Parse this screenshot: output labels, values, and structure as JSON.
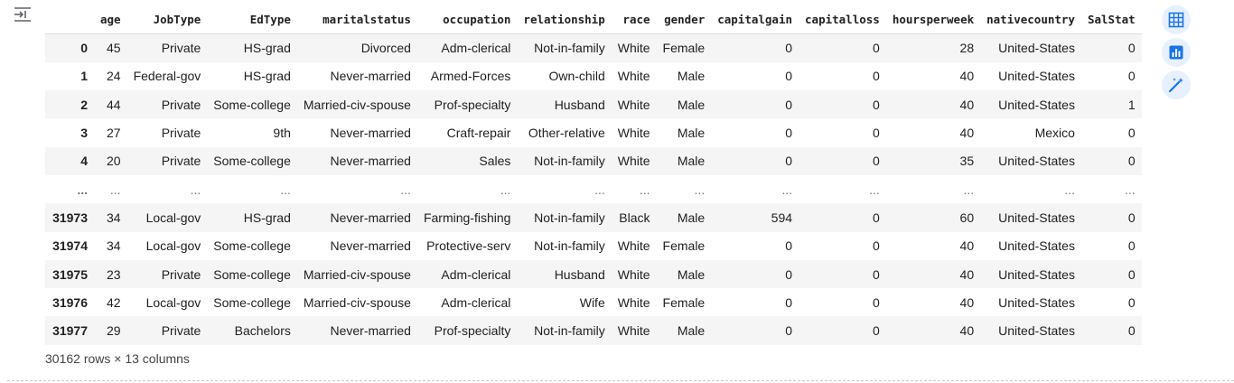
{
  "colors": {
    "accent": "#1a73e8",
    "tool_bg": "#e8f0fe",
    "stripe": "#f5f5f5",
    "text": "#212121"
  },
  "icons": {
    "collapse": "collapse-output-icon",
    "table": "table-icon",
    "chart": "chart-icon",
    "magic": "magic-wand-icon"
  },
  "table": {
    "columns": [
      "",
      "age",
      "JobType",
      "EdType",
      "maritalstatus",
      "occupation",
      "relationship",
      "race",
      "gender",
      "capitalgain",
      "capitalloss",
      "hoursperweek",
      "nativecountry",
      "SalStat"
    ],
    "rows": [
      [
        "0",
        "45",
        "Private",
        "HS-grad",
        "Divorced",
        "Adm-clerical",
        "Not-in-family",
        "White",
        "Female",
        "0",
        "0",
        "28",
        "United-States",
        "0"
      ],
      [
        "1",
        "24",
        "Federal-gov",
        "HS-grad",
        "Never-married",
        "Armed-Forces",
        "Own-child",
        "White",
        "Male",
        "0",
        "0",
        "40",
        "United-States",
        "0"
      ],
      [
        "2",
        "44",
        "Private",
        "Some-college",
        "Married-civ-spouse",
        "Prof-specialty",
        "Husband",
        "White",
        "Male",
        "0",
        "0",
        "40",
        "United-States",
        "1"
      ],
      [
        "3",
        "27",
        "Private",
        "9th",
        "Never-married",
        "Craft-repair",
        "Other-relative",
        "White",
        "Male",
        "0",
        "0",
        "40",
        "Mexico",
        "0"
      ],
      [
        "4",
        "20",
        "Private",
        "Some-college",
        "Never-married",
        "Sales",
        "Not-in-family",
        "White",
        "Male",
        "0",
        "0",
        "35",
        "United-States",
        "0"
      ],
      [
        "...",
        "...",
        "...",
        "...",
        "...",
        "...",
        "...",
        "...",
        "...",
        "...",
        "...",
        "...",
        "...",
        "..."
      ],
      [
        "31973",
        "34",
        "Local-gov",
        "HS-grad",
        "Never-married",
        "Farming-fishing",
        "Not-in-family",
        "Black",
        "Male",
        "594",
        "0",
        "60",
        "United-States",
        "0"
      ],
      [
        "31974",
        "34",
        "Local-gov",
        "Some-college",
        "Never-married",
        "Protective-serv",
        "Not-in-family",
        "White",
        "Female",
        "0",
        "0",
        "40",
        "United-States",
        "0"
      ],
      [
        "31975",
        "23",
        "Private",
        "Some-college",
        "Married-civ-spouse",
        "Adm-clerical",
        "Husband",
        "White",
        "Male",
        "0",
        "0",
        "40",
        "United-States",
        "0"
      ],
      [
        "31976",
        "42",
        "Local-gov",
        "Some-college",
        "Married-civ-spouse",
        "Adm-clerical",
        "Wife",
        "White",
        "Female",
        "0",
        "0",
        "40",
        "United-States",
        "0"
      ],
      [
        "31977",
        "29",
        "Private",
        "Bachelors",
        "Never-married",
        "Prof-specialty",
        "Not-in-family",
        "White",
        "Male",
        "0",
        "0",
        "40",
        "United-States",
        "0"
      ]
    ]
  },
  "shape_text": "30162 rows × 13 columns"
}
